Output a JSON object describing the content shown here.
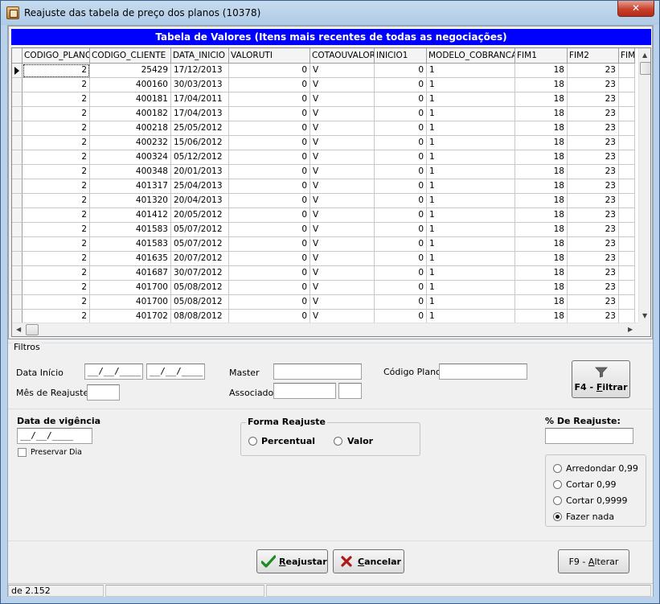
{
  "window": {
    "title": "Reajuste das tabela de preço dos planos (10378)",
    "close_label": "✕"
  },
  "grid": {
    "title": "Tabela de Valores (Itens mais recentes de todas as negociações)",
    "columns": [
      "CODIGO_PLANO",
      "CODIGO_CLIENTE",
      "DATA_INICIO",
      "VALORUTI",
      "COTAOUVALOR",
      "INICIO1",
      "MODELO_COBRANCA",
      "FIM1",
      "FIM2",
      "FIM"
    ],
    "rows": [
      [
        "2",
        "25429",
        "17/12/2013",
        "0",
        "V",
        "0",
        "1",
        "18",
        "23"
      ],
      [
        "2",
        "400160",
        "30/03/2013",
        "0",
        "V",
        "0",
        "1",
        "18",
        "23"
      ],
      [
        "2",
        "400181",
        "17/04/2011",
        "0",
        "V",
        "0",
        "1",
        "18",
        "23"
      ],
      [
        "2",
        "400182",
        "17/04/2013",
        "0",
        "V",
        "0",
        "1",
        "18",
        "23"
      ],
      [
        "2",
        "400218",
        "25/05/2012",
        "0",
        "V",
        "0",
        "1",
        "18",
        "23"
      ],
      [
        "2",
        "400232",
        "15/06/2012",
        "0",
        "V",
        "0",
        "1",
        "18",
        "23"
      ],
      [
        "2",
        "400324",
        "05/12/2012",
        "0",
        "V",
        "0",
        "1",
        "18",
        "23"
      ],
      [
        "2",
        "400348",
        "20/01/2013",
        "0",
        "V",
        "0",
        "1",
        "18",
        "23"
      ],
      [
        "2",
        "401317",
        "25/04/2013",
        "0",
        "V",
        "0",
        "1",
        "18",
        "23"
      ],
      [
        "2",
        "401320",
        "20/04/2013",
        "0",
        "V",
        "0",
        "1",
        "18",
        "23"
      ],
      [
        "2",
        "401412",
        "20/05/2012",
        "0",
        "V",
        "0",
        "1",
        "18",
        "23"
      ],
      [
        "2",
        "401583",
        "05/07/2012",
        "0",
        "V",
        "0",
        "1",
        "18",
        "23"
      ],
      [
        "2",
        "401583",
        "05/07/2012",
        "0",
        "V",
        "0",
        "1",
        "18",
        "23"
      ],
      [
        "2",
        "401635",
        "20/07/2012",
        "0",
        "V",
        "0",
        "1",
        "18",
        "23"
      ],
      [
        "2",
        "401687",
        "30/07/2012",
        "0",
        "V",
        "0",
        "1",
        "18",
        "23"
      ],
      [
        "2",
        "401700",
        "05/08/2012",
        "0",
        "V",
        "0",
        "1",
        "18",
        "23"
      ],
      [
        "2",
        "401700",
        "05/08/2012",
        "0",
        "V",
        "0",
        "1",
        "18",
        "23"
      ],
      [
        "2",
        "401702",
        "08/08/2012",
        "0",
        "V",
        "0",
        "1",
        "18",
        "23"
      ]
    ]
  },
  "filtros": {
    "group_label": "Filtros",
    "data_inicio_label": "Data Início",
    "data_inicio_from": "__/__/____",
    "data_inicio_to": "__/__/____",
    "mes_reajuste_label": "Mês de Reajuste",
    "mes_reajuste_value": "",
    "master_label": "Master",
    "master_value": "",
    "associado_label": "Associado",
    "associado_value": "",
    "associado_extra_value": "",
    "codigo_plano_label": "Código Plano",
    "codigo_plano_value": "",
    "filtrar_prefix": "F4 - ",
    "filtrar_key": "F",
    "filtrar_rest": "iltrar"
  },
  "reajuste": {
    "data_vigencia_label": "Data de vigência",
    "data_vigencia_value": "__/__/____",
    "preservar_dia_label": "Preservar Dia",
    "forma_label": "Forma Reajuste",
    "percentual_label": "Percentual",
    "valor_label": "Valor",
    "percent_label": "% De Reajuste:",
    "percent_value": "",
    "rounding_options": [
      "Arredondar 0,99",
      "Cortar 0,99",
      "Cortar 0,9999",
      "Fazer nada"
    ],
    "rounding_selected": "Fazer nada"
  },
  "actions": {
    "reajustar_key": "R",
    "reajustar_rest": "eajustar",
    "cancelar_key": "C",
    "cancelar_rest": "ancelar",
    "alterar_prefix": "F9 - ",
    "alterar_key": "A",
    "alterar_rest": "lterar"
  },
  "statusbar": {
    "record_info": "de 2.152",
    "pane2": "",
    "pane3": ""
  },
  "colors": {
    "grid_title_bg": "#0000ff",
    "check_icon": "#1f8a1f",
    "cancel_icon": "#b01818"
  }
}
